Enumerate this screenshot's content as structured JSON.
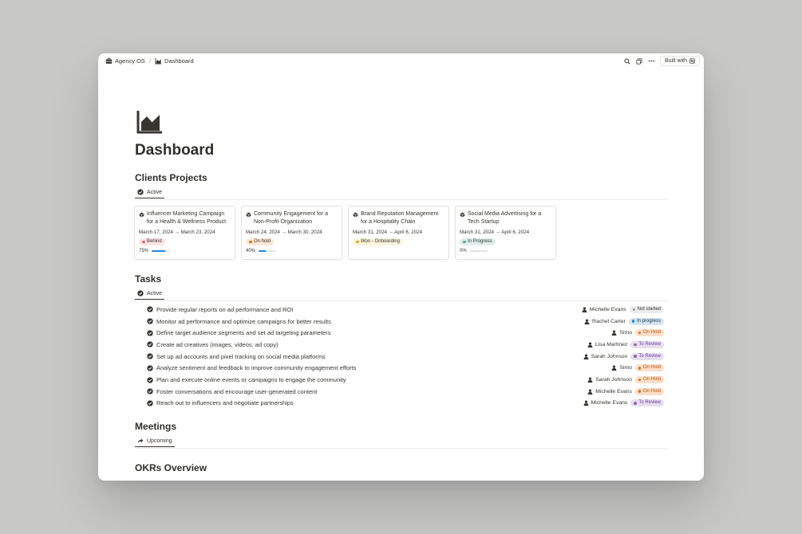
{
  "breadcrumb": {
    "workspace": "Agency OS",
    "page": "Dashboard"
  },
  "toolbar": {
    "built_with": "Built with"
  },
  "page": {
    "title": "Dashboard"
  },
  "clients": {
    "heading": "Clients Projects",
    "tab": "Active",
    "cards": [
      {
        "title": "Influencer Marketing Campaign for a Health & Wellness Product",
        "dates": "March 17, 2024 → March 23, 2024",
        "status": "Behind",
        "status_bg": "#fbe4e4",
        "status_dot": "#e16259",
        "progress": "75%",
        "progress_value": 0.75
      },
      {
        "title": "Community Engagement for a Non-Profit Organization",
        "dates": "March 24, 2024 → March 30, 2024",
        "status": "On hold",
        "status_bg": "#fce8d6",
        "status_dot": "#d9730d",
        "progress": "40%",
        "progress_value": 0.4
      },
      {
        "title": "Brand Reputation Management for a Hospitality Chain",
        "dates": "March 31, 2024 → April 6, 2024",
        "status": "Won - Onboarding",
        "status_bg": "#fbf3db",
        "status_dot": "#dfab01",
        "progress": "",
        "progress_value": null
      },
      {
        "title": "Social Media Advertising for a Tech Startup",
        "dates": "March 31, 2024 → April 6, 2024",
        "status": "In Progress",
        "status_bg": "#ddedea",
        "status_dot": "#4dab9a",
        "progress": "0%",
        "progress_value": 0
      }
    ]
  },
  "tasks": {
    "heading": "Tasks",
    "tab": "Active",
    "rows": [
      {
        "name": "Provide regular reports on ad performance and ROI",
        "assignee": "Michelle Evans",
        "status": "Not started",
        "status_bg": "#ebeced",
        "status_fg": "#37352f",
        "status_dot": "#9b9a97"
      },
      {
        "name": "Monitor ad performance and optimize campaigns for better results",
        "assignee": "Rachel Carter",
        "status": "In progress",
        "status_bg": "#d3e5ef",
        "status_fg": "#183347",
        "status_dot": "#2383e2"
      },
      {
        "name": "Define target audience segments and set ad targeting parameters",
        "assignee": "Simo",
        "status": "On Hold",
        "status_bg": "#fadec9",
        "status_fg": "#c1550d",
        "status_dot": "#d9730d"
      },
      {
        "name": "Create ad creatives (images, videos, ad copy)",
        "assignee": "Lisa Martinez",
        "status": "To Review",
        "status_bg": "#e8deee",
        "status_fg": "#6940a5",
        "status_dot": "#9065b0"
      },
      {
        "name": "Set up ad accounts and pixel tracking on social media platforms",
        "assignee": "Sarah Johnson",
        "status": "To Review",
        "status_bg": "#e8deee",
        "status_fg": "#6940a5",
        "status_dot": "#9065b0"
      },
      {
        "name": "Analyze sentiment and feedback to improve community engagement efforts",
        "assignee": "Simo",
        "status": "On Hold",
        "status_bg": "#fadec9",
        "status_fg": "#c1550d",
        "status_dot": "#d9730d"
      },
      {
        "name": "Plan and execute online events or campaigns to engage the community",
        "assignee": "Sarah Johnson",
        "status": "On Hold",
        "status_bg": "#fadec9",
        "status_fg": "#c1550d",
        "status_dot": "#d9730d"
      },
      {
        "name": "Foster conversations and encourage user-generated content",
        "assignee": "Michelle Evans",
        "status": "On Hold",
        "status_bg": "#fadec9",
        "status_fg": "#c1550d",
        "status_dot": "#d9730d"
      },
      {
        "name": "Reach out to influencers and negotiate partnerships",
        "assignee": "Michelle Evans",
        "status": "To Review",
        "status_bg": "#e8deee",
        "status_fg": "#6940a5",
        "status_dot": "#9065b0"
      }
    ]
  },
  "meetings": {
    "heading": "Meetings",
    "tab": "Upcoming"
  },
  "okrs": {
    "heading": "OKRs Overview"
  },
  "icons": {
    "workspace": "briefcase-icon",
    "page": "chart-icon",
    "search": "search-icon",
    "duplicate": "duplicate-icon",
    "more": "more-icon",
    "card": "cube-icon",
    "task": "check-circle-icon",
    "person": "person-icon"
  }
}
